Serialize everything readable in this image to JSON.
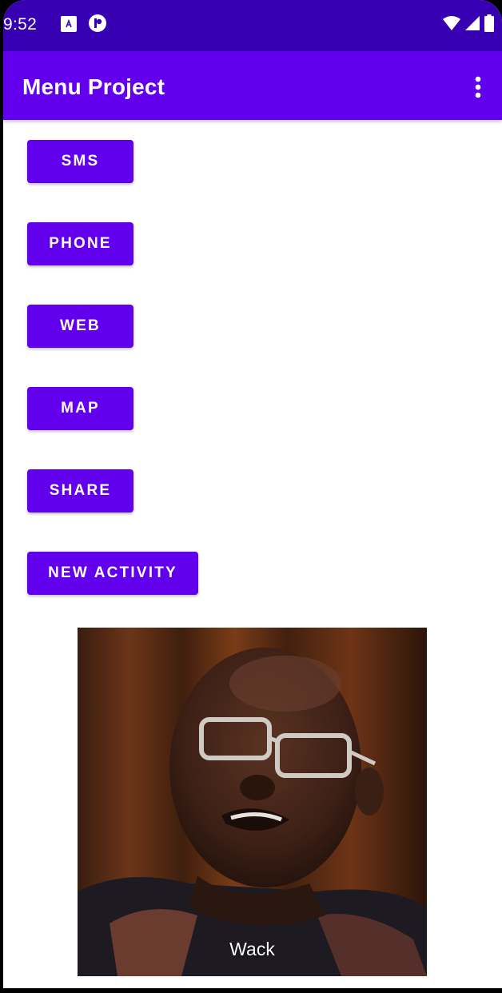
{
  "status_bar": {
    "time": "9:52",
    "icons": [
      "notification-a-icon",
      "notification-p-icon",
      "wifi-icon",
      "signal-icon",
      "battery-icon"
    ]
  },
  "app_bar": {
    "title": "Menu Project",
    "overflow_icon": "more-vert-icon"
  },
  "buttons": [
    {
      "label": "SMS"
    },
    {
      "label": "PHONE"
    },
    {
      "label": "WEB"
    },
    {
      "label": "MAP"
    },
    {
      "label": "SHARE"
    },
    {
      "label": "NEW ACTIVITY"
    }
  ],
  "image": {
    "caption": "Wack"
  },
  "colors": {
    "status_bar": "#3700b3",
    "primary": "#6200ee",
    "background": "#ffffff"
  }
}
